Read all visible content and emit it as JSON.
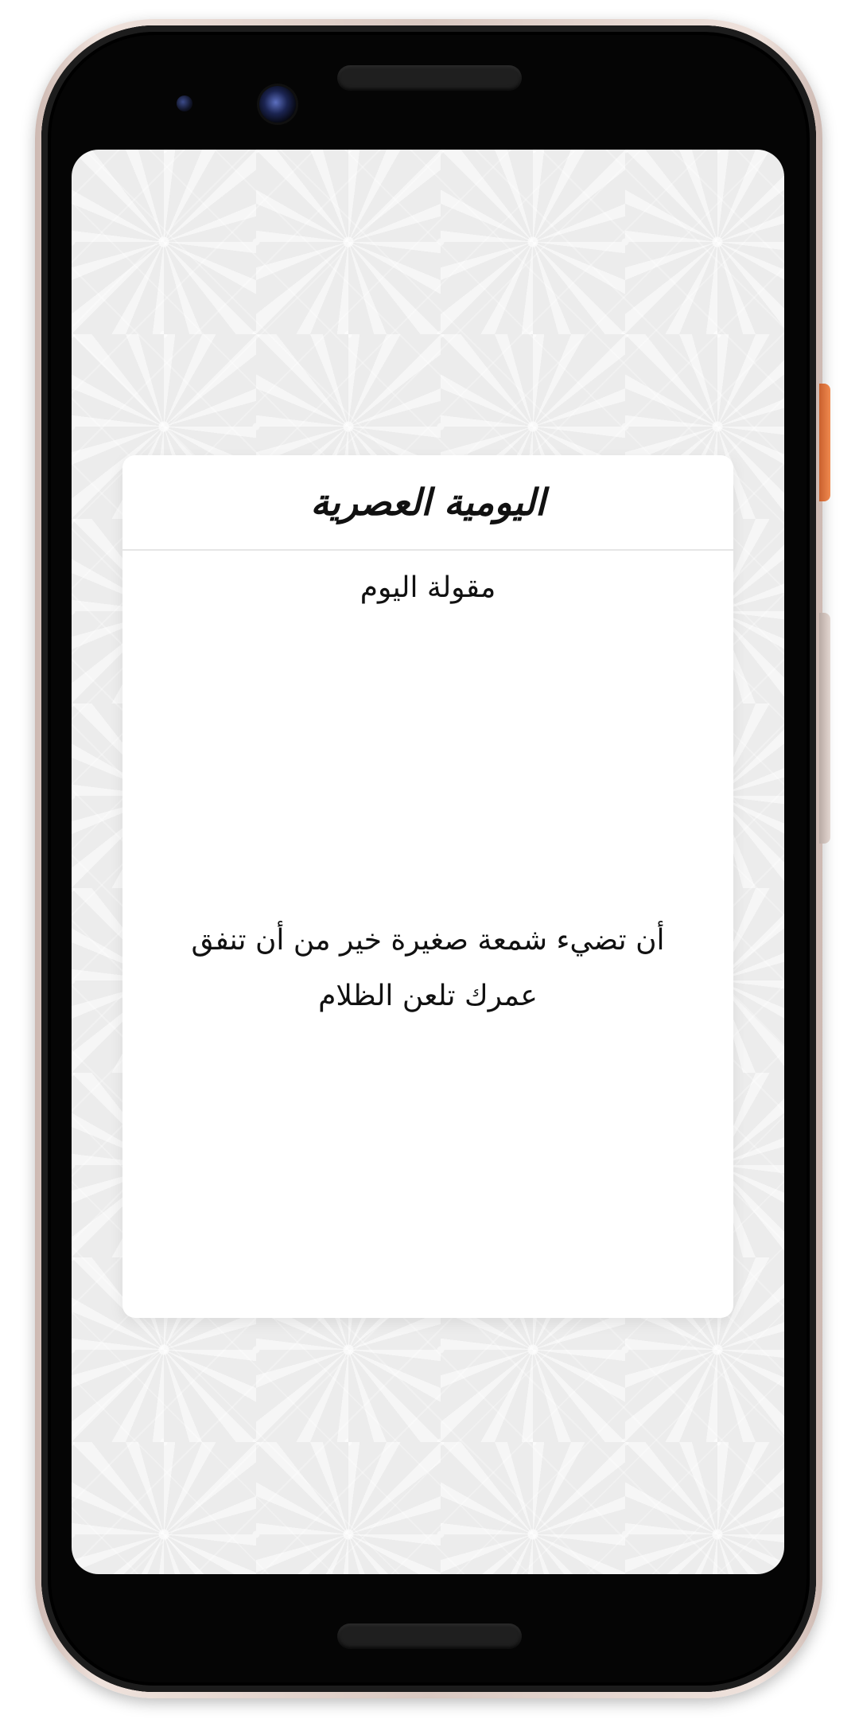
{
  "app": {
    "title": "اليومية العصرية"
  },
  "quote_card": {
    "section_title": "مقولة اليوم",
    "quote": "أن تضيء شمعة صغيرة خير من أن تنفق عمرك تلعن الظلام"
  },
  "colors": {
    "background_pattern": "#ececec",
    "card": "#ffffff",
    "text": "#111111",
    "divider": "#e6e6e6",
    "power_button_accent": "#f08a4f"
  },
  "icons": {
    "device_frame": "phone-frame-icon",
    "camera": "camera-icon",
    "sensor": "sensor-icon"
  }
}
